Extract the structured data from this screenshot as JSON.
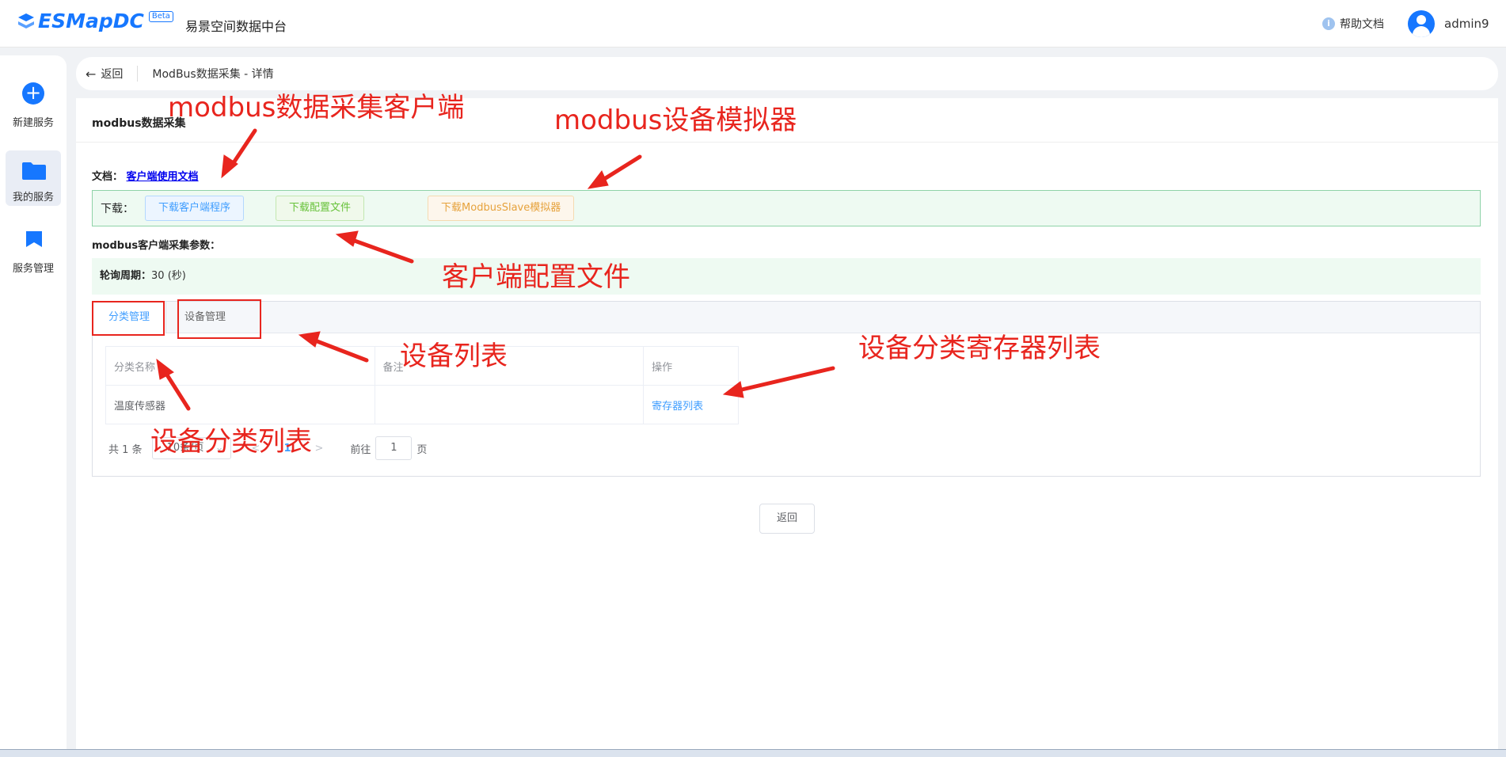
{
  "header": {
    "logo_text": "ESMapDC",
    "logo_badge": "Beta",
    "app_name": "易景空间数据中台",
    "help_label": "帮助文档",
    "user_name": "admin9"
  },
  "sidebar": {
    "items": [
      {
        "label": "新建服务",
        "icon": "plus-icon"
      },
      {
        "label": "我的服务",
        "icon": "folder-icon"
      },
      {
        "label": "服务管理",
        "icon": "bookmark-icon"
      }
    ]
  },
  "breadcrumb": {
    "back_label": "返回",
    "title": "ModBus数据采集 - 详情"
  },
  "card": {
    "title": "modbus数据采集",
    "doc_prefix": "文档：",
    "doc_link": "客户端使用文档",
    "download_label": "下载：",
    "download_client": "下载客户端程序",
    "download_config": "下载配置文件",
    "download_slave": "下载ModbusSlave模拟器",
    "params_label": "modbus客户端采集参数：",
    "poll_label": "轮询周期：",
    "poll_value": "30 (秒)"
  },
  "tabs": [
    {
      "label": "分类管理",
      "active": true
    },
    {
      "label": "设备管理",
      "active": false
    }
  ],
  "table": {
    "columns": [
      "分类名称",
      "备注",
      "操作"
    ],
    "rows": [
      {
        "name": "温度传感器",
        "remark": "",
        "action": "寄存器列表"
      }
    ]
  },
  "pagination": {
    "total": "共 1 条",
    "page_size": "10条/页",
    "current_page": "1",
    "goto_label": "前往",
    "goto_value": "1",
    "page_suffix": "页"
  },
  "bottom_back_label": "返回",
  "annotations": {
    "client": "modbus数据采集客户端",
    "simulator": "modbus设备模拟器",
    "config_file": "客户端配置文件",
    "device_list": "设备列表",
    "register_list": "设备分类寄存器列表",
    "category_list": "设备分类列表",
    "color": "#e8251e"
  },
  "colors": {
    "brand": "#1677ff",
    "link": "#409eff",
    "success_bg": "#eefaf2",
    "annotation": "#e8251e"
  }
}
